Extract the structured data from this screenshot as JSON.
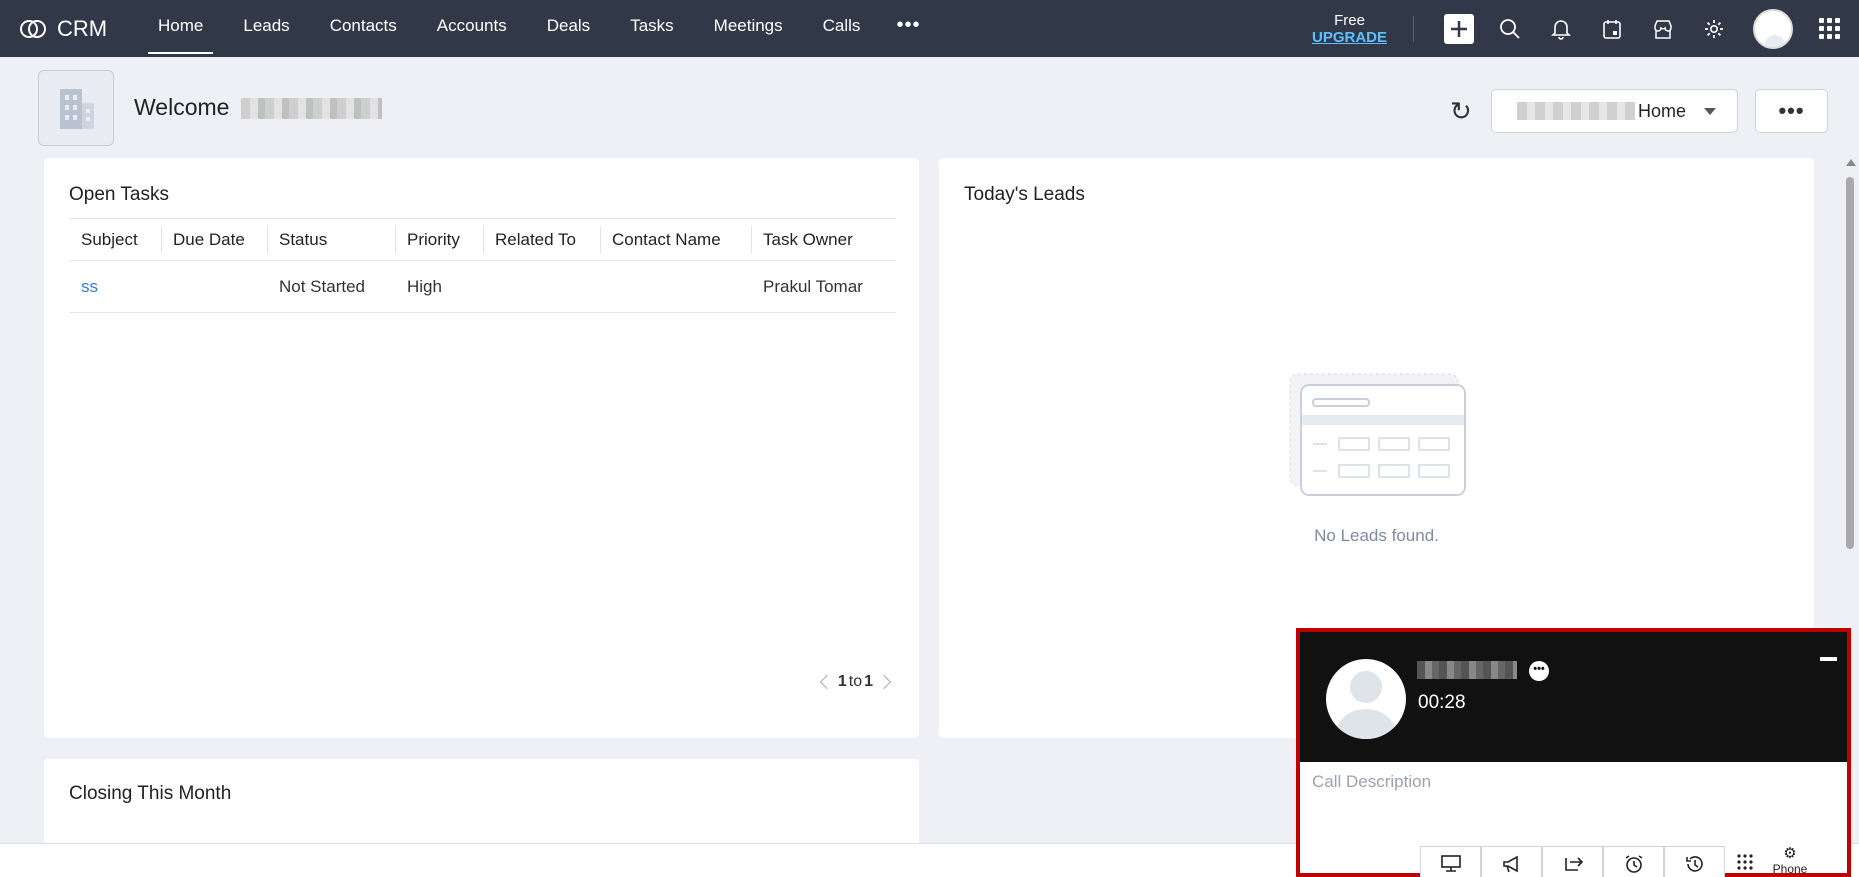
{
  "brand": {
    "name": "CRM"
  },
  "nav": {
    "items": [
      "Home",
      "Leads",
      "Contacts",
      "Accounts",
      "Deals",
      "Tasks",
      "Meetings",
      "Calls"
    ],
    "more": "•••"
  },
  "upgrade": {
    "free": "Free",
    "link": "UPGRADE"
  },
  "header": {
    "welcome": "Welcome",
    "home_select_label": "Home",
    "more_label": "•••"
  },
  "open_tasks": {
    "title": "Open Tasks",
    "columns": [
      "Subject",
      "Due Date",
      "Status",
      "Priority",
      "Related To",
      "Contact Name",
      "Task Owner"
    ],
    "rows": [
      {
        "subject": "ss",
        "due_date": "",
        "status": "Not Started",
        "priority": "High",
        "related_to": "",
        "contact_name": "",
        "task_owner": "Prakul Tomar"
      }
    ],
    "pager": {
      "from": "1",
      "to_word": "to",
      "to": "1"
    }
  },
  "todays_leads": {
    "title": "Today's Leads",
    "empty_text": "No Leads found."
  },
  "closing": {
    "title": "Closing This Month"
  },
  "call_widget": {
    "timer": "00:28",
    "description_placeholder": "Call Description",
    "phone_label": "Phone"
  },
  "colors": {
    "topbar": "#313949",
    "accent_link": "#2f7fd8",
    "upgrade": "#5ec1ff",
    "highlight_border": "#c00000"
  }
}
